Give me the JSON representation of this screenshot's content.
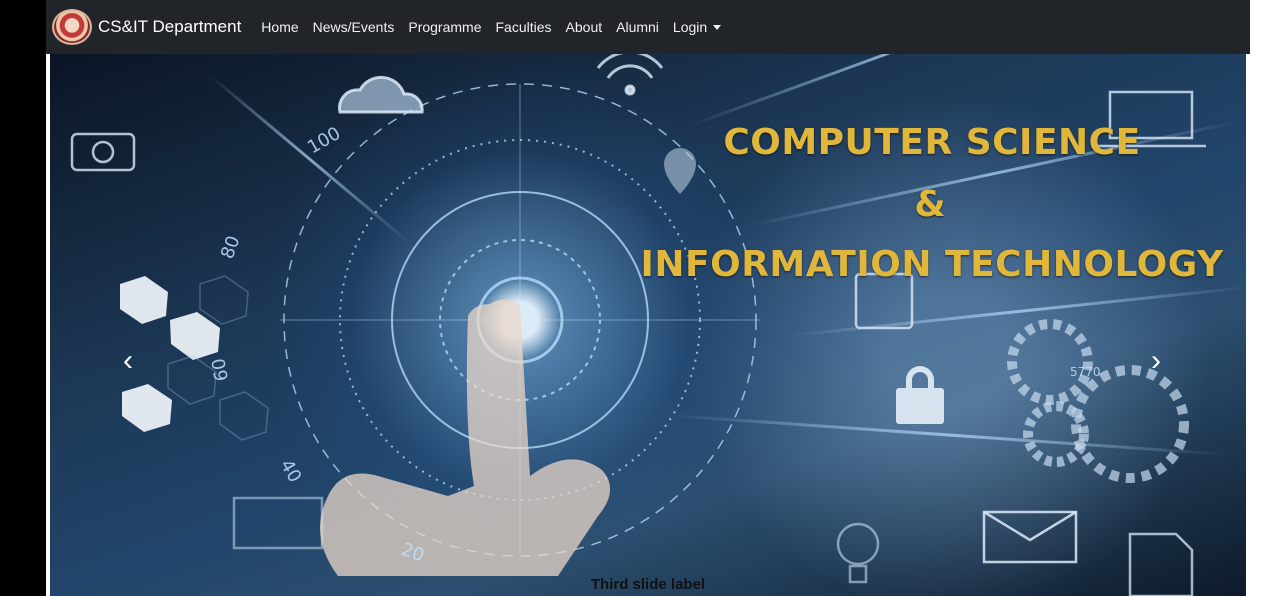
{
  "navbar": {
    "brand": "CS&IT Department",
    "items": [
      "Home",
      "News/Events",
      "Programme",
      "Faculties",
      "About",
      "Alumni"
    ],
    "login": "Login"
  },
  "carousel": {
    "headline_line1": "COMPUTER SCIENCE",
    "headline_line2": "&",
    "headline_line3": "INFORMATION TECHNOLOGY",
    "caption": "Third slide label",
    "dial_labels": [
      "100",
      "80",
      "60",
      "40",
      "20"
    ],
    "gear_label": "5770",
    "accent_color": "#e0b63b",
    "navbar_color": "#212529"
  }
}
